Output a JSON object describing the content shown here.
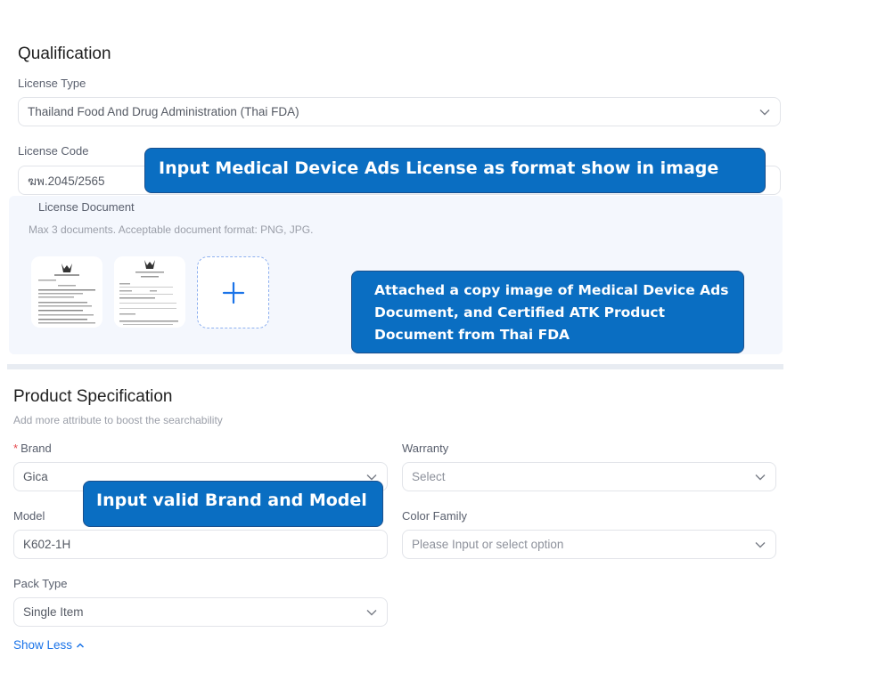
{
  "qualification": {
    "title": "Qualification",
    "license_type": {
      "label": "License Type",
      "value": "Thailand Food And Drug Administration (Thai FDA)",
      "icon": "chevron-down-icon"
    },
    "license_code": {
      "label": "License Code",
      "value": "ฆพ.2045/2565"
    },
    "license_document": {
      "label": "License Document",
      "hint": "Max 3 documents. Acceptable document format: PNG, JPG.",
      "documents": [
        {
          "name": "license-document-thumbnail-1"
        },
        {
          "name": "license-document-thumbnail-2"
        }
      ],
      "add_icon": "plus-icon"
    }
  },
  "product_specification": {
    "title": "Product Specification",
    "subtitle": "Add more attribute to boost the searchability",
    "fields": {
      "brand": {
        "label": "Brand",
        "required_mark": "*",
        "value": "Gica"
      },
      "warranty": {
        "label": "Warranty",
        "placeholder": "Select"
      },
      "model": {
        "label": "Model",
        "value": "K602-1H"
      },
      "color_family": {
        "label": "Color Family",
        "placeholder": "Please Input or select option"
      },
      "pack_type": {
        "label": "Pack Type",
        "value": "Single Item"
      }
    },
    "show_less": "Show Less"
  },
  "callouts": {
    "license_code": "Input Medical Device Ads License as format show in image",
    "documents": "Attached a copy image of Medical Device Ads Document, and  Certified ATK Product Document from Thai FDA",
    "brand_model": "Input valid Brand and Model"
  },
  "colors": {
    "callout_bg": "#0a6ec2",
    "link": "#1a73e8",
    "required": "#e5484d",
    "panel_bg": "#f4f7fd"
  }
}
